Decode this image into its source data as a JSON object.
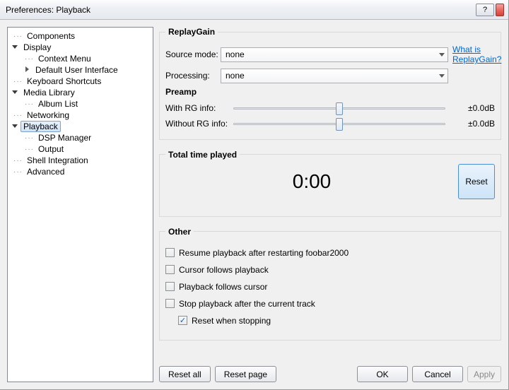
{
  "window": {
    "title": "Preferences: Playback"
  },
  "titlebar": {
    "help": "?"
  },
  "tree": {
    "components": "Components",
    "display": "Display",
    "context_menu": "Context Menu",
    "default_ui": "Default User Interface",
    "keyboard_shortcuts": "Keyboard Shortcuts",
    "media_library": "Media Library",
    "album_list": "Album List",
    "networking": "Networking",
    "playback": "Playback",
    "dsp_manager": "DSP Manager",
    "output": "Output",
    "shell_integration": "Shell Integration",
    "advanced": "Advanced"
  },
  "replaygain": {
    "legend": "ReplayGain",
    "source_label": "Source mode:",
    "source_value": "none",
    "processing_label": "Processing:",
    "processing_value": "none",
    "help_link": "What is ReplayGain?",
    "preamp_label": "Preamp",
    "with_rg_label": "With RG info:",
    "without_rg_label": "Without RG info:",
    "with_rg_db": "±0.0dB",
    "without_rg_db": "±0.0dB"
  },
  "total_time": {
    "legend": "Total time played",
    "value": "0:00",
    "reset": "Reset"
  },
  "other": {
    "legend": "Other",
    "resume": "Resume playback after restarting foobar2000",
    "cursor_follows": "Cursor follows playback",
    "playback_follows": "Playback follows cursor",
    "stop_after": "Stop playback after the current track",
    "reset_stop": "Reset when stopping"
  },
  "footer": {
    "reset_all": "Reset all",
    "reset_page": "Reset page",
    "ok": "OK",
    "cancel": "Cancel",
    "apply": "Apply"
  }
}
